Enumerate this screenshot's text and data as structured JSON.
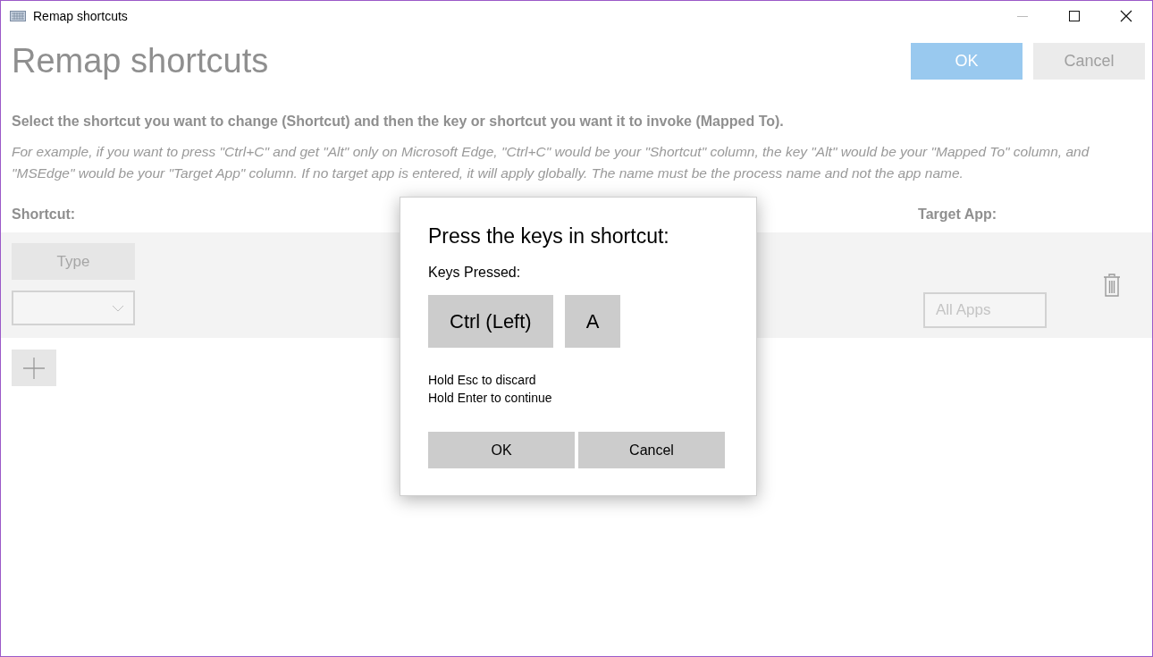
{
  "window": {
    "title": "Remap shortcuts"
  },
  "page": {
    "heading": "Remap shortcuts",
    "ok_button": "OK",
    "cancel_button": "Cancel"
  },
  "instruction": "Select the shortcut you want to change (Shortcut) and then the key or shortcut you want it to invoke (Mapped To).",
  "example": "For example, if you want to press \"Ctrl+C\" and get \"Alt\" only on Microsoft Edge, \"Ctrl+C\" would be your \"Shortcut\" column, the key \"Alt\" would be your \"Mapped To\" column, and \"MSEdge\" would be your \"Target App\" column. If no target app is entered, it will apply globally. The name must be the process name and not the app name.",
  "columns": {
    "shortcut": "Shortcut:",
    "target_app": "Target App:"
  },
  "rows": [
    {
      "type_button": "Type",
      "target_placeholder": "All Apps"
    }
  ],
  "dialog": {
    "title": "Press the keys in shortcut:",
    "keys_label": "Keys Pressed:",
    "keys": [
      "Ctrl (Left)",
      "A"
    ],
    "hints": [
      "Hold Esc to discard",
      "Hold Enter to continue"
    ],
    "ok_button": "OK",
    "cancel_button": "Cancel"
  }
}
